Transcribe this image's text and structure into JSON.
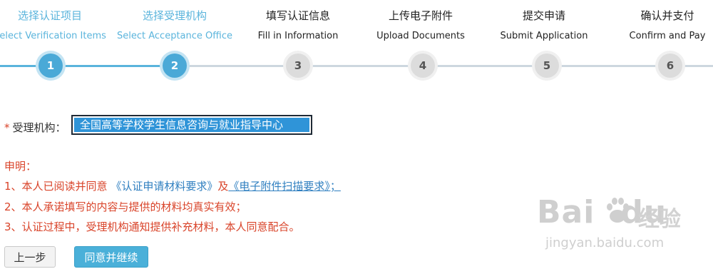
{
  "steps": [
    {
      "zh": "选择认证项目",
      "en": "Select Verification Items",
      "num": "1",
      "state": "done"
    },
    {
      "zh": "选择受理机构",
      "en": "Select Acceptance Office",
      "num": "2",
      "state": "done"
    },
    {
      "zh": "填写认证信息",
      "en": "Fill in Information",
      "num": "3",
      "state": "todo"
    },
    {
      "zh": "上传电子附件",
      "en": "Upload Documents",
      "num": "4",
      "state": "todo"
    },
    {
      "zh": "提交申请",
      "en": "Submit Application",
      "num": "5",
      "state": "todo"
    },
    {
      "zh": "确认并支付",
      "en": "Confirm and Pay",
      "num": "6",
      "state": "todo"
    }
  ],
  "agency": {
    "required_mark": "*",
    "label": "受理机构：",
    "selected": "全国高等学校学生信息咨询与就业指导中心"
  },
  "declaration": {
    "title": "申明：",
    "line1_prefix": "1、本人已阅读并同意",
    "link1": "《认证申请材料要求》",
    "line1_mid": "及",
    "link2": "《电子附件扫描要求》；",
    "line2": "2、本人承诺填写的内容与提供的材料均真实有效；",
    "line3": "3、认证过程中，受理机构通知提供补充材料，本人同意配合。"
  },
  "buttons": {
    "prev": "上一步",
    "next": "同意并继续"
  },
  "watermark": {
    "logo_left": "Bai",
    "logo_right": "du",
    "jingyan": "经验",
    "url": "jingyan.baidu.com"
  },
  "colors": {
    "done": "#4aa9d7",
    "todo": "#dcdcdc",
    "declaration": "#d9442a",
    "link": "#2f7fc0",
    "primary_button": "#4ab0d9"
  }
}
